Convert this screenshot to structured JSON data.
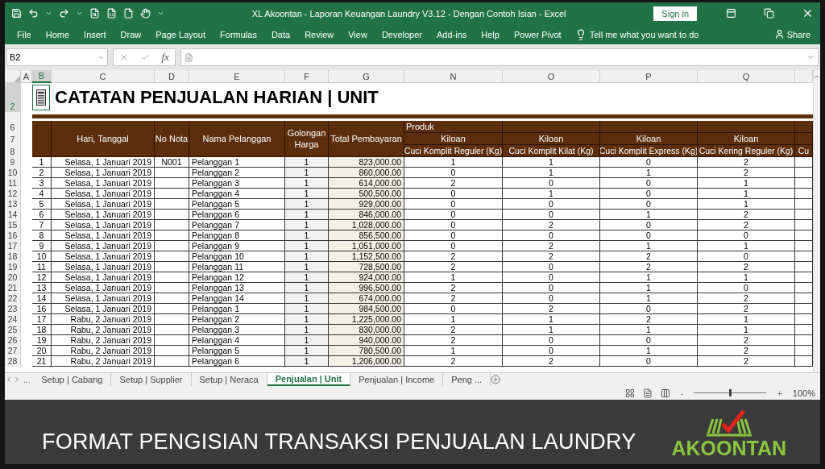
{
  "title_bar": {
    "title": "XL Akoontan - Laporan Keuangan Laundry V3.12 - Dengan Contoh Isian  -  Excel",
    "sign_in": "Sign in"
  },
  "ribbon_tabs": [
    {
      "label": "File",
      "selected": false
    },
    {
      "label": "Home",
      "selected": false
    },
    {
      "label": "Insert",
      "selected": false
    },
    {
      "label": "Draw",
      "selected": false
    },
    {
      "label": "Page Layout",
      "selected": false
    },
    {
      "label": "Formulas",
      "selected": false
    },
    {
      "label": "Data",
      "selected": false
    },
    {
      "label": "Review",
      "selected": false
    },
    {
      "label": "View",
      "selected": false
    },
    {
      "label": "Developer",
      "selected": false
    },
    {
      "label": "Add-ins",
      "selected": false
    },
    {
      "label": "Help",
      "selected": false
    },
    {
      "label": "Power Pivot",
      "selected": false
    }
  ],
  "tell_me": "Tell me what you want to do",
  "share": "Share",
  "formula_bar": {
    "name_box": "B2",
    "function_label": "fx"
  },
  "column_headers": [
    {
      "label": "A",
      "selected": false
    },
    {
      "label": "B",
      "selected": true
    },
    {
      "label": "C",
      "selected": false
    },
    {
      "label": "D",
      "selected": false
    },
    {
      "label": "E",
      "selected": false
    },
    {
      "label": "F",
      "selected": false
    },
    {
      "label": "G",
      "selected": false
    },
    {
      "label": "N",
      "selected": false
    },
    {
      "label": "O",
      "selected": false
    },
    {
      "label": "P",
      "selected": false
    },
    {
      "label": "Q",
      "selected": false
    }
  ],
  "title_row": {
    "row": "2",
    "selected": true,
    "title": "CATATAN PENJUALAN HARIAN | UNIT"
  },
  "table_header": {
    "rows": [
      "6",
      "7",
      "8"
    ],
    "date": "Hari, Tanggal",
    "nota": "No Nota",
    "customer": "Nama Pelanggan",
    "group": "Golongan Harga",
    "total": "Total Pembayaran",
    "product": "Produk",
    "categories": [
      "Kiloan",
      "Kiloan",
      "Kiloan",
      "Kiloan"
    ],
    "products": [
      "Cuci Komplit Reguler (Kg)",
      "Cuci Komplit Kilat  (Kg)",
      "Cuci Komplit Express (Kg)",
      "Cuci Kering Reguler  (Kg)",
      "Cu"
    ]
  },
  "rows": [
    {
      "row": "9",
      "no": "1",
      "date": "Selasa, 1 Januari 2019",
      "nota": "N001",
      "customer": "Pelanggan 1",
      "group": "1",
      "total": "823,000.00",
      "qty": [
        "1",
        "1",
        "0",
        "2"
      ]
    },
    {
      "row": "10",
      "no": "2",
      "date": "Selasa, 1 Januari 2019",
      "customer": "Pelanggan 2",
      "group": "1",
      "total": "860,000.00",
      "qty": [
        "0",
        "1",
        "1",
        "2"
      ]
    },
    {
      "row": "11",
      "no": "3",
      "date": "Selasa, 1 Januari 2019",
      "customer": "Pelanggan 3",
      "group": "1",
      "total": "614,000.00",
      "qty": [
        "2",
        "0",
        "0",
        "1"
      ]
    },
    {
      "row": "12",
      "no": "4",
      "date": "Selasa, 1 Januari 2019",
      "customer": "Pelanggan 4",
      "group": "1",
      "total": "500,500.00",
      "qty": [
        "0",
        "1",
        "0",
        "1"
      ]
    },
    {
      "row": "13",
      "no": "5",
      "date": "Selasa, 1 Januari 2019",
      "customer": "Pelanggan 5",
      "group": "1",
      "total": "929,000.00",
      "qty": [
        "0",
        "0",
        "0",
        "1"
      ]
    },
    {
      "row": "14",
      "no": "6",
      "date": "Selasa, 1 Januari 2019",
      "customer": "Pelanggan 6",
      "group": "1",
      "total": "846,000.00",
      "qty": [
        "0",
        "0",
        "1",
        "2"
      ]
    },
    {
      "row": "15",
      "no": "7",
      "date": "Selasa, 1 Januari 2019",
      "customer": "Pelanggan 7",
      "group": "1",
      "total": "1,028,000.00",
      "qty": [
        "0",
        "2",
        "0",
        "2"
      ]
    },
    {
      "row": "16",
      "no": "8",
      "date": "Selasa, 1 Januari 2019",
      "customer": "Pelanggan 8",
      "group": "1",
      "total": "856,500.00",
      "qty": [
        "0",
        "0",
        "0",
        "0"
      ]
    },
    {
      "row": "17",
      "no": "9",
      "date": "Selasa, 1 Januari 2019",
      "customer": "Pelanggan 9",
      "group": "1",
      "total": "1,051,000.00",
      "qty": [
        "0",
        "2",
        "1",
        "1"
      ]
    },
    {
      "row": "18",
      "no": "10",
      "date": "Selasa, 1 Januari 2019",
      "customer": "Pelanggan 10",
      "group": "1",
      "total": "1,152,500.00",
      "qty": [
        "2",
        "2",
        "2",
        "0"
      ]
    },
    {
      "row": "19",
      "no": "11",
      "date": "Selasa, 1 Januari 2019",
      "customer": "Pelanggan 11",
      "group": "1",
      "total": "728,500.00",
      "qty": [
        "2",
        "0",
        "2",
        "2"
      ]
    },
    {
      "row": "20",
      "no": "12",
      "date": "Selasa, 1 Januari 2019",
      "customer": "Pelanggan 12",
      "group": "1",
      "total": "924,000.00",
      "qty": [
        "1",
        "0",
        "1",
        "1"
      ]
    },
    {
      "row": "21",
      "no": "13",
      "date": "Selasa, 1 Januari 2019",
      "customer": "Pelanggan 13",
      "group": "1",
      "total": "996,500.00",
      "qty": [
        "2",
        "0",
        "1",
        "0"
      ]
    },
    {
      "row": "22",
      "no": "14",
      "date": "Selasa, 1 Januari 2019",
      "customer": "Pelanggan 14",
      "group": "1",
      "total": "674,000.00",
      "qty": [
        "2",
        "0",
        "1",
        "2"
      ]
    },
    {
      "row": "23",
      "no": "16",
      "date": "Selasa, 1 Januari 2019",
      "customer": "Pelanggan 1",
      "group": "1",
      "total": "984,500.00",
      "qty": [
        "0",
        "2",
        "0",
        "2"
      ]
    },
    {
      "row": "24",
      "no": "17",
      "date": "Rabu, 2 Januari 2019",
      "customer": "Pelanggan 2",
      "group": "1",
      "total": "1,225,000.00",
      "qty": [
        "1",
        "1",
        "2",
        "1"
      ]
    },
    {
      "row": "25",
      "no": "18",
      "date": "Rabu, 2 Januari 2019",
      "customer": "Pelanggan 3",
      "group": "1",
      "total": "830,000.00",
      "qty": [
        "2",
        "1",
        "1",
        "1"
      ]
    },
    {
      "row": "26",
      "no": "19",
      "date": "Rabu, 2 Januari 2019",
      "customer": "Pelanggan 4",
      "group": "1",
      "total": "940,000.00",
      "qty": [
        "2",
        "0",
        "0",
        "2"
      ]
    },
    {
      "row": "27",
      "no": "20",
      "date": "Rabu, 2 Januari 2019",
      "customer": "Pelanggan 5",
      "group": "1",
      "total": "780,500.00",
      "qty": [
        "1",
        "0",
        "1",
        "2"
      ]
    },
    {
      "row": "28",
      "no": "21",
      "date": "Rabu, 2 Januari 2019",
      "customer": "Pelanggan 6",
      "group": "1",
      "total": "1,206,000.00",
      "qty": [
        "2",
        "2",
        "0",
        "2"
      ]
    }
  ],
  "sheet_tabs": [
    {
      "label": "Setup | Cabang",
      "selected": false
    },
    {
      "label": "Setup | Supplier",
      "selected": false
    },
    {
      "label": "Setup | Neraca",
      "selected": false
    },
    {
      "label": "Penjualan | Unit",
      "selected": true
    },
    {
      "label": "Penjualan | Income",
      "selected": false
    },
    {
      "label": "Peng ...",
      "selected": false
    }
  ],
  "sheet_nav_more": "...",
  "status_bar": {
    "zoom_out": "-",
    "zoom_in": "+",
    "zoom_slider": {
      "level": 0.5
    },
    "zoom": "100%"
  },
  "caption": {
    "text": "FORMAT PENGISIAN TRANSAKSI PENJUALAN LAUNDRY",
    "logo": "AKOONTAN"
  }
}
